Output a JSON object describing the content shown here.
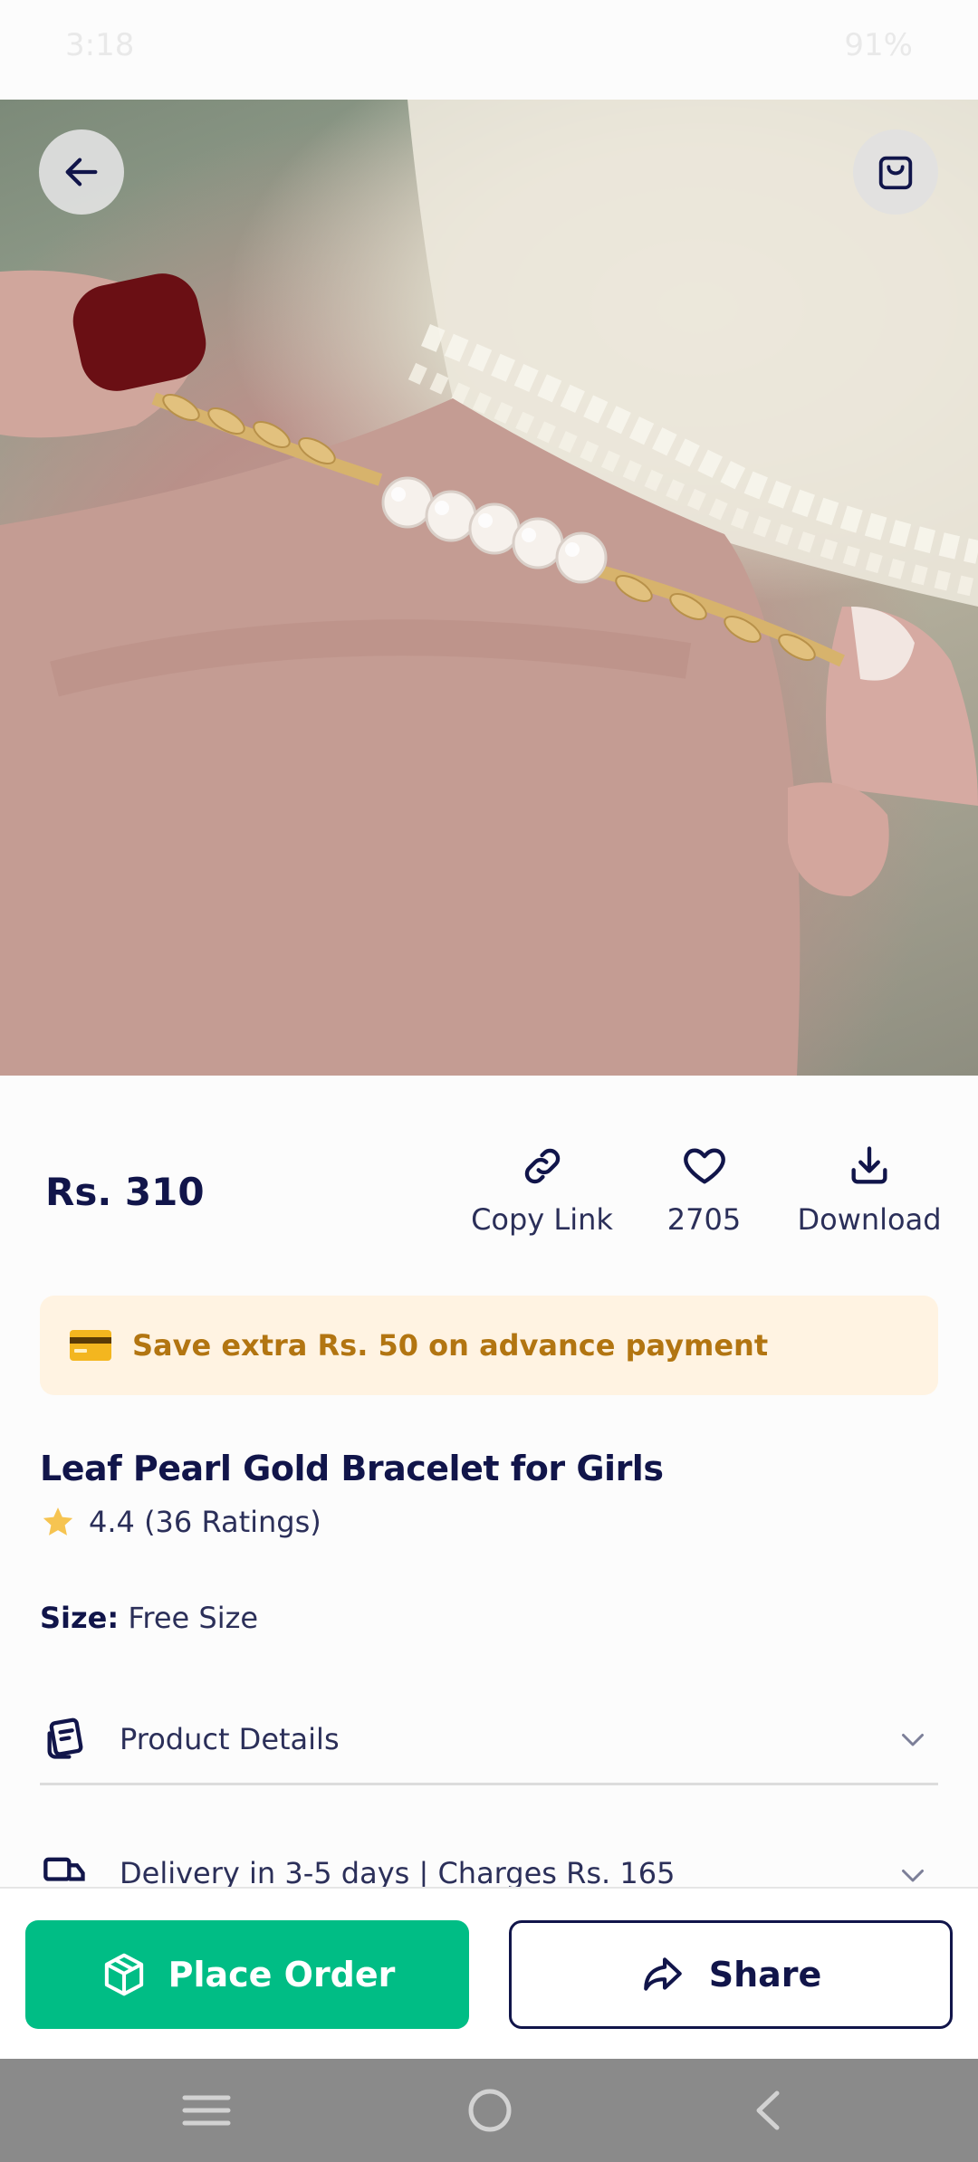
{
  "status_bar": {
    "time": "3:18",
    "battery": "91%"
  },
  "gallery": {
    "image_count": 7,
    "active_index": 1
  },
  "product": {
    "price": "Rs. 310",
    "title": "Leaf Pearl Gold Bracelet for Girls",
    "rating": "4.4 (36 Ratings)",
    "size_label": "Size:",
    "size_value": "Free Size"
  },
  "actions": {
    "copy_link": "Copy Link",
    "likes": "2705",
    "download": "Download"
  },
  "banner": {
    "text": "Save extra Rs. 50 on advance payment"
  },
  "sections": {
    "details": "Product Details",
    "delivery": "Delivery in 3-5 days | Charges Rs. 165"
  },
  "buttons": {
    "place_order": "Place Order",
    "share": "Share"
  },
  "colors": {
    "primary_green": "#00bd85",
    "navy": "#11154a",
    "banner_bg": "#fff3e2",
    "banner_text": "#b27511"
  }
}
